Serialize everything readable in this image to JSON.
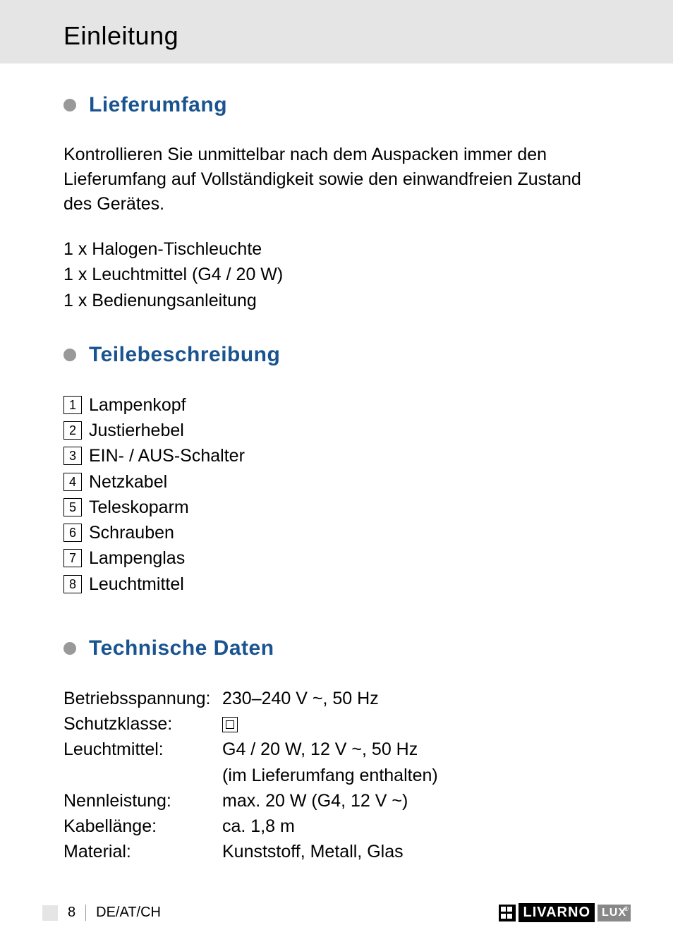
{
  "header": {
    "title": "Einleitung"
  },
  "sections": {
    "lieferumfang": {
      "title": "Lieferumfang",
      "intro": "Kontrollieren Sie unmittelbar nach dem Auspacken immer den Lieferumfang auf Vollständigkeit sowie den einwandfreien Zustand des Gerätes.",
      "items": [
        "1 x  Halogen-Tischleuchte",
        "1 x  Leuchtmittel (G4 / 20 W)",
        "1 x  Bedienungsanleitung"
      ]
    },
    "teilebeschreibung": {
      "title": "Teilebeschreibung",
      "parts": [
        {
          "n": "1",
          "label": "Lampenkopf"
        },
        {
          "n": "2",
          "label": "Justierhebel"
        },
        {
          "n": "3",
          "label": "EIN- / AUS-Schalter"
        },
        {
          "n": "4",
          "label": "Netzkabel"
        },
        {
          "n": "5",
          "label": "Teleskoparm"
        },
        {
          "n": "6",
          "label": "Schrauben"
        },
        {
          "n": "7",
          "label": "Lampenglas"
        },
        {
          "n": "8",
          "label": "Leuchtmittel"
        }
      ]
    },
    "technische": {
      "title": "Technische Daten",
      "rows": [
        {
          "key": "Betriebsspannung:",
          "val": "230–240 V ~, 50 Hz"
        },
        {
          "key": "Schutzklasse:",
          "val": "",
          "icon": "class2"
        },
        {
          "key": "Leuchtmittel:",
          "val": "G4 / 20 W, 12 V ~, 50 Hz"
        },
        {
          "key": "",
          "val": "(im Lieferumfang enthalten)"
        },
        {
          "key": "Nennleistung:",
          "val": "max. 20 W (G4, 12 V ~)"
        },
        {
          "key": "Kabellänge:",
          "val": "ca. 1,8 m"
        },
        {
          "key": "Material:",
          "val": "Kunststoff, Metall, Glas"
        }
      ]
    }
  },
  "footer": {
    "page": "8",
    "lang": "DE/AT/CH",
    "brand": {
      "name": "LIVARNO",
      "sub": "LUX"
    }
  }
}
